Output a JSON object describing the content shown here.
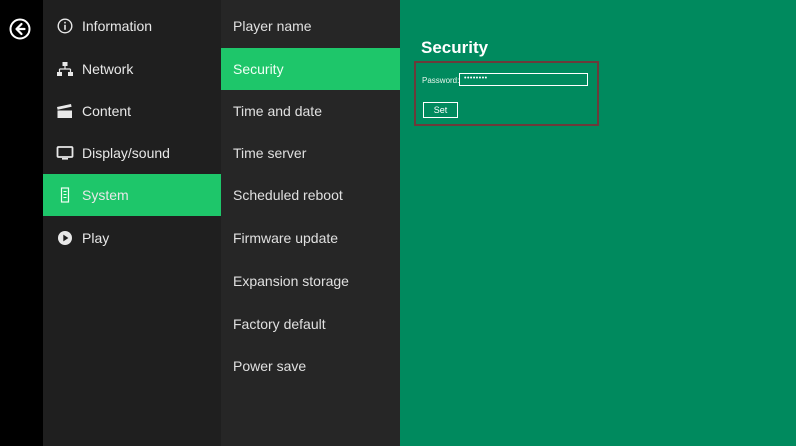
{
  "nav": {
    "back_icon": "arrow-left-circle-icon"
  },
  "menu1": {
    "items": [
      {
        "label": "Information",
        "icon": "info-icon"
      },
      {
        "label": "Network",
        "icon": "network-icon"
      },
      {
        "label": "Content",
        "icon": "clapperboard-icon"
      },
      {
        "label": "Display/sound",
        "icon": "monitor-icon"
      },
      {
        "label": "System",
        "icon": "system-icon",
        "active": true
      },
      {
        "label": "Play",
        "icon": "play-icon"
      }
    ]
  },
  "menu2": {
    "items": [
      {
        "label": "Player name"
      },
      {
        "label": "Security",
        "active": true
      },
      {
        "label": "Time and date"
      },
      {
        "label": "Time server"
      },
      {
        "label": "Scheduled reboot"
      },
      {
        "label": "Firmware update"
      },
      {
        "label": "Expansion storage"
      },
      {
        "label": "Factory default"
      },
      {
        "label": "Power save"
      }
    ]
  },
  "panel": {
    "title": "Security",
    "password_label": "Password:",
    "password_value": "••••••••",
    "set_label": "Set"
  },
  "colors": {
    "accent": "#1ec66a",
    "panel_bg": "#008a5e",
    "menu1_bg": "#1f1f1f",
    "menu2_bg": "#262626",
    "highlight_border": "#6b3a3a"
  }
}
